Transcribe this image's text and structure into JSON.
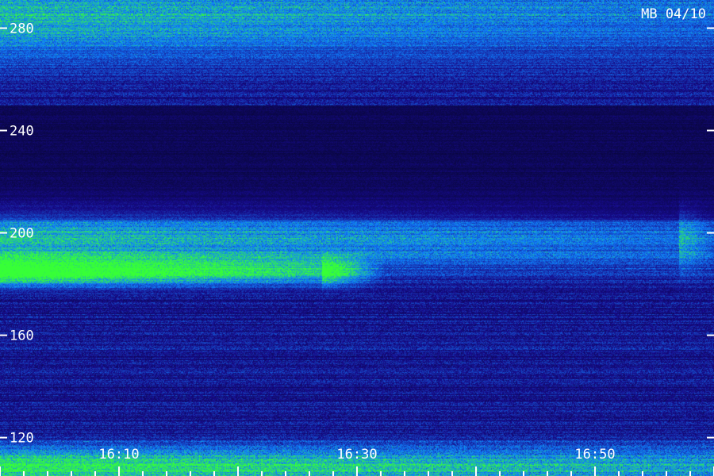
{
  "chart_data": {
    "type": "heatmap",
    "title": "MB 04/10",
    "xlabel": "",
    "ylabel": "",
    "y_ticks": [
      120,
      160,
      200,
      240,
      280
    ],
    "y_range": [
      105,
      291
    ],
    "x_time_ticks": [
      "16:10",
      "16:30",
      "16:50"
    ],
    "x_time_range_minutes": [
      0,
      60
    ],
    "x_tick_minutes": [
      10,
      30,
      50
    ],
    "bands": [
      {
        "y_center": 185,
        "y_halfwidth": 3,
        "intensity": 0.95,
        "extent": [
          0,
          0.45
        ]
      },
      {
        "y_center": 197,
        "y_halfwidth": 8,
        "intensity": 0.6,
        "extent": [
          0,
          0.95
        ]
      },
      {
        "y_center": 282,
        "y_halfwidth": 10,
        "intensity": 0.55,
        "extent": [
          0,
          1
        ]
      },
      {
        "y_center": 109,
        "y_halfwidth": 4,
        "intensity": 0.65,
        "extent": [
          0,
          1
        ]
      }
    ],
    "colors": {
      "background": "#0a0a4a",
      "low": "#1a1aa0",
      "mid": "#1a6aff",
      "high": "#30ff60",
      "text": "#ffffff"
    }
  }
}
